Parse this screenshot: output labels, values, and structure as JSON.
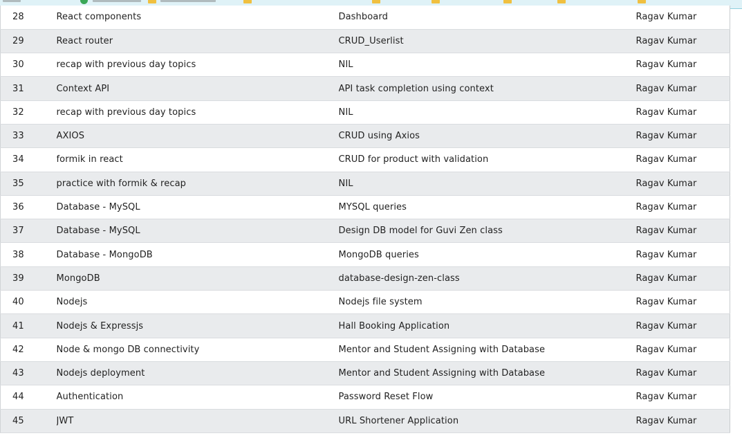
{
  "rows": [
    {
      "day": "28",
      "topic": "React components",
      "task": "Dashboard",
      "mentor": "Ragav Kumar"
    },
    {
      "day": "29",
      "topic": "React router",
      "task": "CRUD_Userlist",
      "mentor": "Ragav Kumar"
    },
    {
      "day": "30",
      "topic": "recap with previous day topics",
      "task": "NIL",
      "mentor": "Ragav Kumar"
    },
    {
      "day": "31",
      "topic": "Context API",
      "task": "API task completion using context",
      "mentor": "Ragav Kumar"
    },
    {
      "day": "32",
      "topic": "recap with previous day topics",
      "task": "NIL",
      "mentor": "Ragav Kumar"
    },
    {
      "day": "33",
      "topic": "AXIOS",
      "task": "CRUD using Axios",
      "mentor": "Ragav Kumar"
    },
    {
      "day": "34",
      "topic": "formik in react",
      "task": "CRUD for product with validation",
      "mentor": "Ragav Kumar"
    },
    {
      "day": "35",
      "topic": "practice with formik & recap",
      "task": "NIL",
      "mentor": "Ragav Kumar"
    },
    {
      "day": "36",
      "topic": "Database - MySQL",
      "task": "MYSQL queries",
      "mentor": "Ragav Kumar"
    },
    {
      "day": "37",
      "topic": "Database - MySQL",
      "task": "Design DB model for Guvi Zen class",
      "mentor": "Ragav Kumar"
    },
    {
      "day": "38",
      "topic": "Database - MongoDB",
      "task": "MongoDB queries",
      "mentor": "Ragav Kumar"
    },
    {
      "day": "39",
      "topic": "MongoDB",
      "task": "database-design-zen-class",
      "mentor": "Ragav Kumar"
    },
    {
      "day": "40",
      "topic": "Nodejs",
      "task": "Nodejs file system",
      "mentor": "Ragav Kumar"
    },
    {
      "day": "41",
      "topic": "Nodejs & Expressjs",
      "task": "Hall Booking Application",
      "mentor": "Ragav Kumar"
    },
    {
      "day": "42",
      "topic": "Node & mongo DB connectivity",
      "task": "Mentor and Student Assigning with Database",
      "mentor": "Ragav Kumar"
    },
    {
      "day": "43",
      "topic": "Nodejs deployment",
      "task": "Mentor and Student Assigning with Database",
      "mentor": "Ragav Kumar"
    },
    {
      "day": "44",
      "topic": "Authentication",
      "task": "Password Reset Flow",
      "mentor": "Ragav Kumar"
    },
    {
      "day": "45",
      "topic": "JWT",
      "task": "URL Shortener Application",
      "mentor": "Ragav Kumar"
    }
  ]
}
